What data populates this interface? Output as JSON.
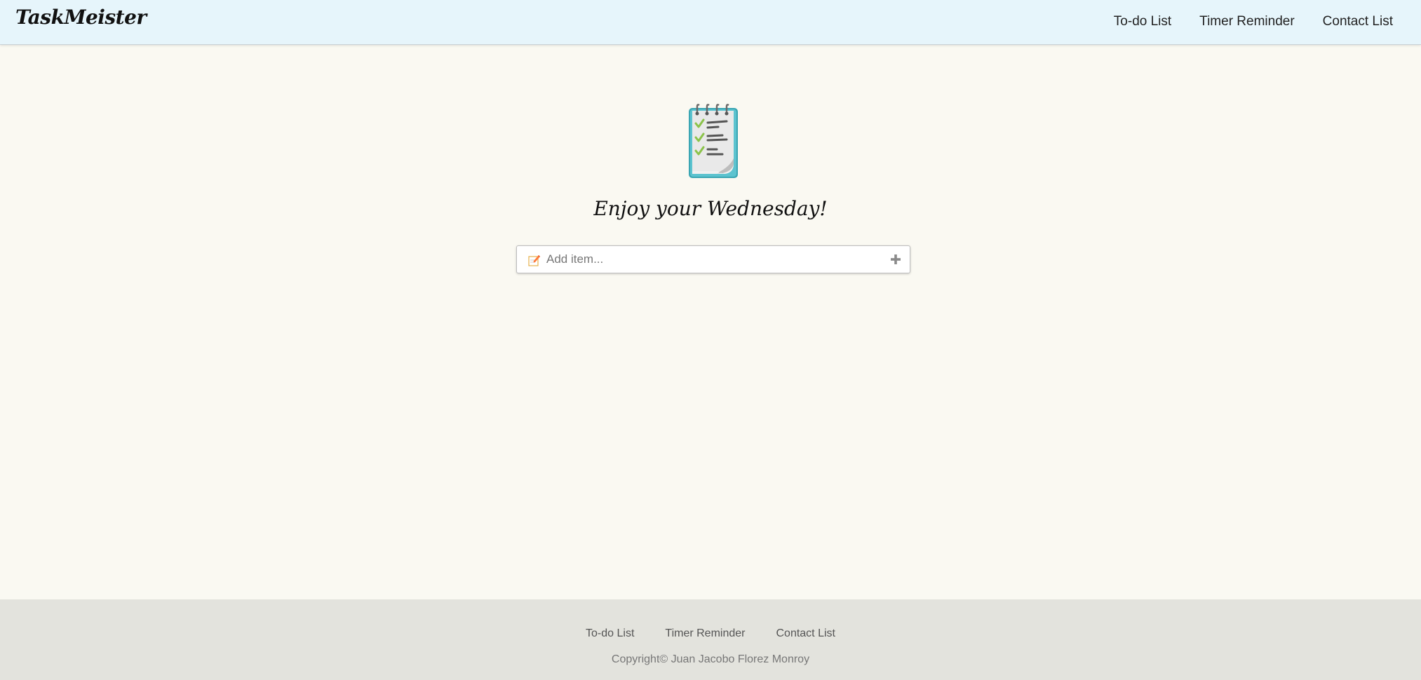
{
  "brand": "TaskMeister",
  "nav": {
    "items": [
      {
        "label": "To-do List"
      },
      {
        "label": "Timer Reminder"
      },
      {
        "label": "Contact List"
      }
    ]
  },
  "main": {
    "icon": "notepad-checklist-icon",
    "greeting": "Enjoy your Wednesday!",
    "add_item": {
      "placeholder": "Add item...",
      "value": "",
      "leading_icon": "memo-icon",
      "trailing_icon": "plus-icon"
    }
  },
  "footer": {
    "links": [
      {
        "label": "To-do List"
      },
      {
        "label": "Timer Reminder"
      },
      {
        "label": "Contact List"
      }
    ],
    "copyright": "Copyright© Juan Jacobo Florez Monroy"
  },
  "colors": {
    "navbar_bg": "#e6f5fb",
    "page_bg": "#faf9f2",
    "footer_bg": "#e3e3dd",
    "notepad_teal": "#4fb8c4"
  }
}
